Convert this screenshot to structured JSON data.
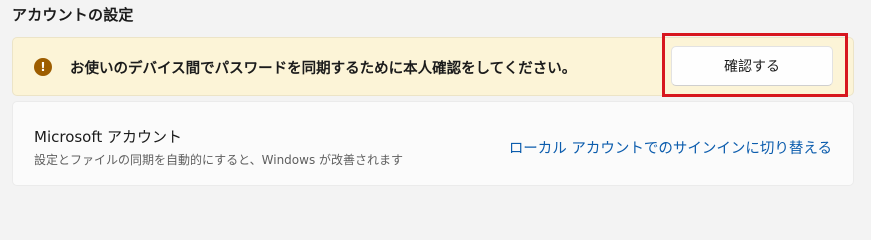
{
  "section": {
    "title": "アカウントの設定"
  },
  "warning": {
    "icon": "warning-icon",
    "icon_glyph": "!",
    "message": "お使いのデバイス間でパスワードを同期するために本人確認をしてください。",
    "button_label": "確認する",
    "background": "#fcf4d7",
    "icon_color": "#9d5d00",
    "highlight_color": "#d7161e"
  },
  "account": {
    "title": "Microsoft アカウント",
    "description": "設定とファイルの同期を自動的にすると、Windows が改善されます",
    "link_label": "ローカル アカウントでのサインインに切り替える",
    "link_color": "#0b5cad"
  }
}
